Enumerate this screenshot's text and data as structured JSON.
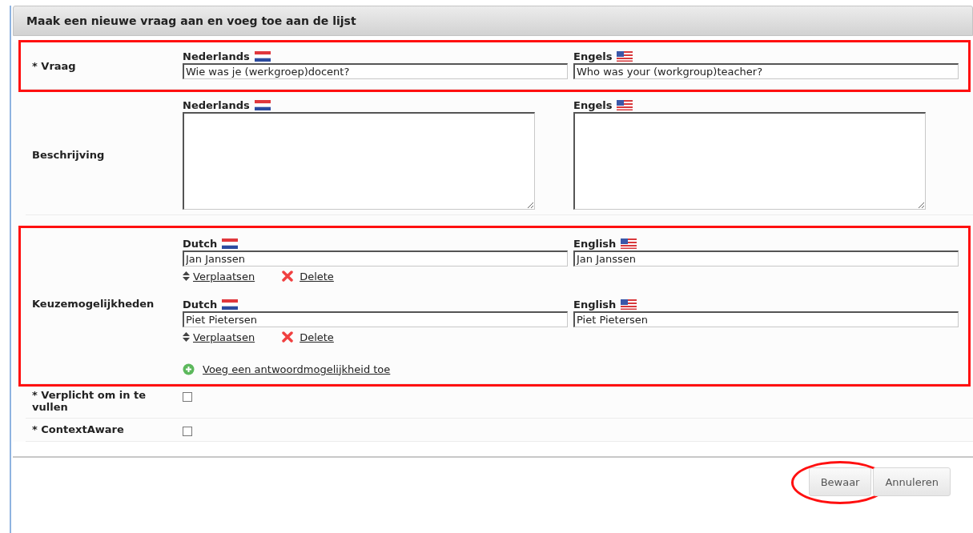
{
  "panel": {
    "title": "Maak een nieuwe vraag aan en voeg toe aan de lijst"
  },
  "question": {
    "label": "* Vraag",
    "highlighted": true,
    "fields": [
      {
        "language": "Nederlands",
        "kind": "nl",
        "value": "Wie was je (werkgroep)docent?"
      },
      {
        "language": "Engels",
        "kind": "us",
        "value": "Who was your (workgroup)teacher?"
      }
    ]
  },
  "description": {
    "label": "Beschrijving",
    "highlighted": false,
    "fields": [
      {
        "language": "Nederlands",
        "kind": "nl"
      },
      {
        "language": "Engels",
        "kind": "us"
      }
    ]
  },
  "choices": {
    "label": "Keuzemogelijkheden",
    "highlighted": true,
    "options": [
      {
        "fields": [
          {
            "language": "Dutch",
            "kind": "nl",
            "value": "Jan Janssen"
          },
          {
            "language": "English",
            "kind": "us",
            "value": "Jan Janssen"
          }
        ],
        "move": "Verplaatsen",
        "delete": "Delete"
      },
      {
        "fields": [
          {
            "language": "Dutch",
            "kind": "nl",
            "value": "Piet Pietersen"
          },
          {
            "language": "English",
            "kind": "us",
            "value": "Piet Pietersen"
          }
        ],
        "move": "Verplaatsen",
        "delete": "Delete"
      }
    ],
    "add": "Voeg een antwoordmogelijkheid toe"
  },
  "checkboxes": [
    {
      "label": "* Verplicht om in te vullen",
      "checked": false
    },
    {
      "label": "* ContextAware",
      "checked": false
    }
  ],
  "buttons": [
    {
      "label": "Bewaar",
      "circled": true
    },
    {
      "label": "Annuleren",
      "circled": false
    }
  ]
}
